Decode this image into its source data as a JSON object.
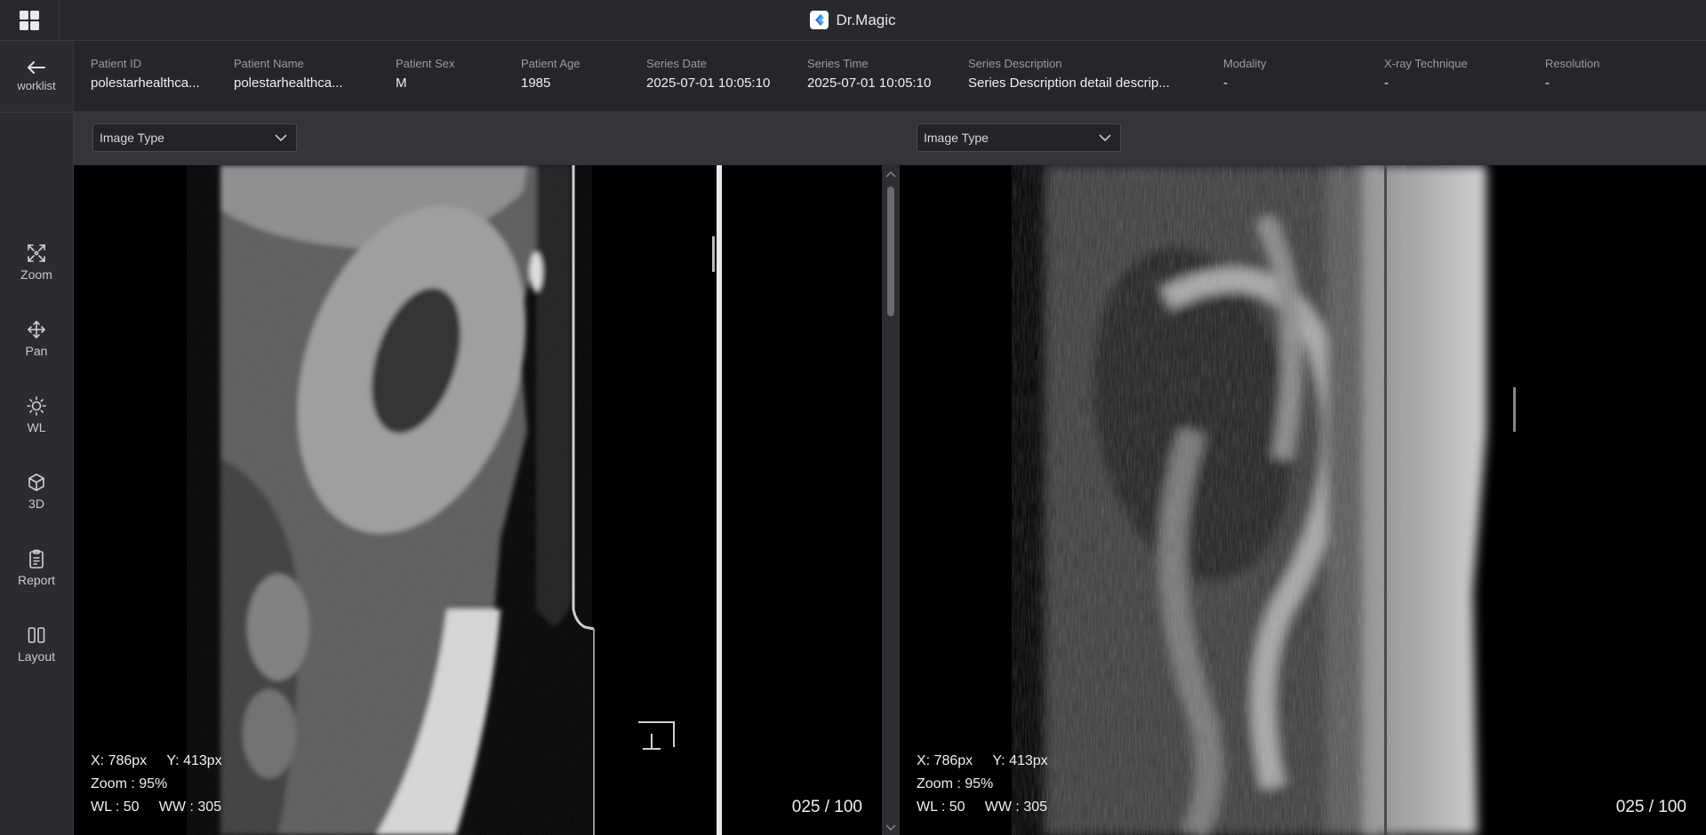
{
  "app": {
    "title": "Dr.Magic"
  },
  "nav": {
    "back_label": "worklist"
  },
  "tools": [
    {
      "label": "Zoom",
      "icon": "zoom-icon"
    },
    {
      "label": "Pan",
      "icon": "pan-icon"
    },
    {
      "label": "WL",
      "icon": "window-level-icon"
    },
    {
      "label": "3D",
      "icon": "cube-icon"
    },
    {
      "label": "Report",
      "icon": "clipboard-icon"
    },
    {
      "label": "Layout",
      "icon": "layout-columns-icon"
    }
  ],
  "patient": {
    "fields": [
      {
        "label": "Patient ID",
        "value": "polestarhealthca..."
      },
      {
        "label": "Patient Name",
        "value": "polestarhealthca..."
      },
      {
        "label": "Patient Sex",
        "value": "M"
      },
      {
        "label": "Patient Age",
        "value": "1985"
      },
      {
        "label": "Series Date",
        "value": "2025-07-01 10:05:10"
      },
      {
        "label": "Series Time",
        "value": "2025-07-01 10:05:10"
      },
      {
        "label": "Series Description",
        "value": "Series Description detail descrip..."
      },
      {
        "label": "Modality",
        "value": "-"
      },
      {
        "label": "X-ray Technique",
        "value": "-"
      },
      {
        "label": "Resolution",
        "value": "-"
      }
    ]
  },
  "viewports": [
    {
      "image_type": "Image Type",
      "x": "X: 786px",
      "y": "Y: 413px",
      "zoom": "Zoom : 95%",
      "wl": "WL : 50",
      "ww": "WW : 305",
      "counter": "025 / 100"
    },
    {
      "image_type": "Image Type",
      "x": "X: 786px",
      "y": "Y: 413px",
      "zoom": "Zoom : 95%",
      "wl": "WL : 50",
      "ww": "WW : 305",
      "counter": "025 / 100"
    }
  ],
  "colors": {
    "background": "#2f3034",
    "topbar": "#28292c",
    "viewer": "#000000"
  }
}
